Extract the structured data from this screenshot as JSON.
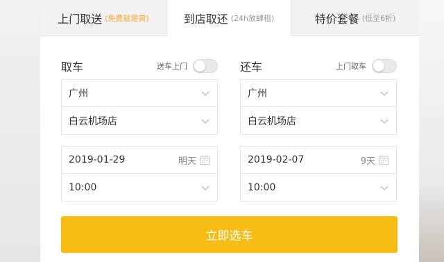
{
  "tabs": [
    {
      "label": "上门取送",
      "note": "(免费就是爽)"
    },
    {
      "label": "到店取还",
      "note": "(24h放肆租)"
    },
    {
      "label": "特价套餐",
      "note": "(低至6折)"
    }
  ],
  "pickup": {
    "title": "取车",
    "toggle_label": "送车上门",
    "toggle_on": false,
    "city": "广州",
    "store": "白云机场店",
    "date": "2019-01-29",
    "date_note": "明天",
    "time": "10:00"
  },
  "return": {
    "title": "还车",
    "toggle_label": "上门取车",
    "toggle_on": false,
    "city": "广州",
    "store": "白云机场店",
    "date": "2019-02-07",
    "date_note": "9天",
    "time": "10:00"
  },
  "submit_label": "立即选车",
  "colors": {
    "accent": "#f8bd14",
    "note_orange": "#f7a633"
  }
}
